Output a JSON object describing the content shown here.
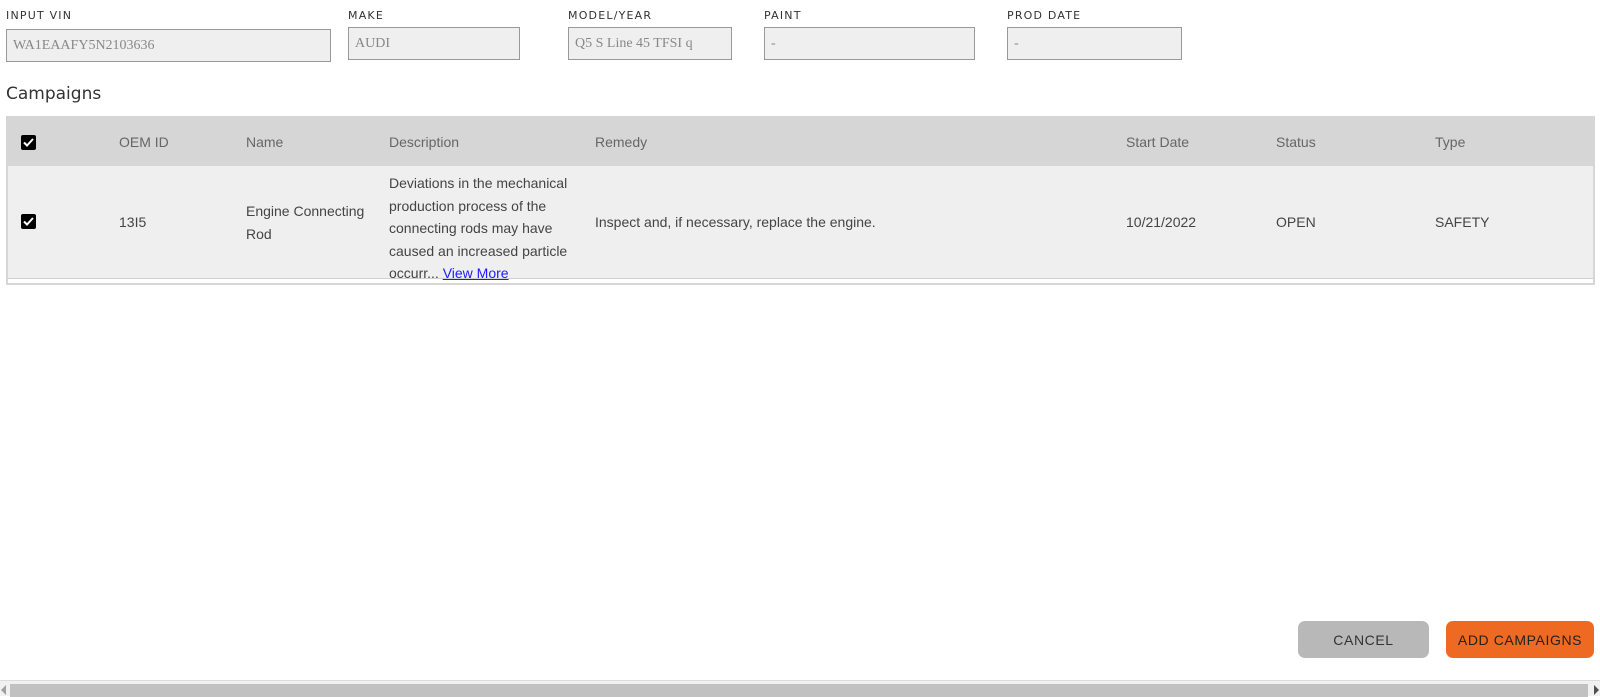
{
  "vehicle": {
    "vin": {
      "label": "INPUT VIN",
      "value": "WA1EAAFY5N2103636"
    },
    "make": {
      "label": "MAKE",
      "value": "AUDI"
    },
    "model_year": {
      "label": "MODEL/YEAR",
      "value": "Q5 S Line 45 TFSI q"
    },
    "paint": {
      "label": "PAINT",
      "value": "-"
    },
    "prod_date": {
      "label": "PROD DATE",
      "value": "-"
    }
  },
  "campaigns": {
    "title": "Campaigns",
    "headers": {
      "oem_id": "OEM ID",
      "name": "Name",
      "description": "Description",
      "remedy": "Remedy",
      "start_date": "Start Date",
      "status": "Status",
      "type": "Type"
    },
    "select_all_checked": true,
    "rows": [
      {
        "checked": true,
        "oem_id": "13I5",
        "name": "Engine Connecting Rod",
        "description": "Deviations in the mechanical production process of the connecting rods may have caused an increased particle occurr...",
        "view_more": "View More",
        "remedy": "Inspect and, if necessary, replace the engine.",
        "start_date": "10/21/2022",
        "status": "OPEN",
        "type": "SAFETY"
      }
    ]
  },
  "actions": {
    "cancel": "CANCEL",
    "add": "ADD CAMPAIGNS"
  },
  "colors": {
    "accent": "#ee6a22",
    "cancel_bg": "#b8b8b8",
    "header_bg": "#d6d6d6",
    "row_bg": "#efefef",
    "link": "#1a1aff"
  }
}
